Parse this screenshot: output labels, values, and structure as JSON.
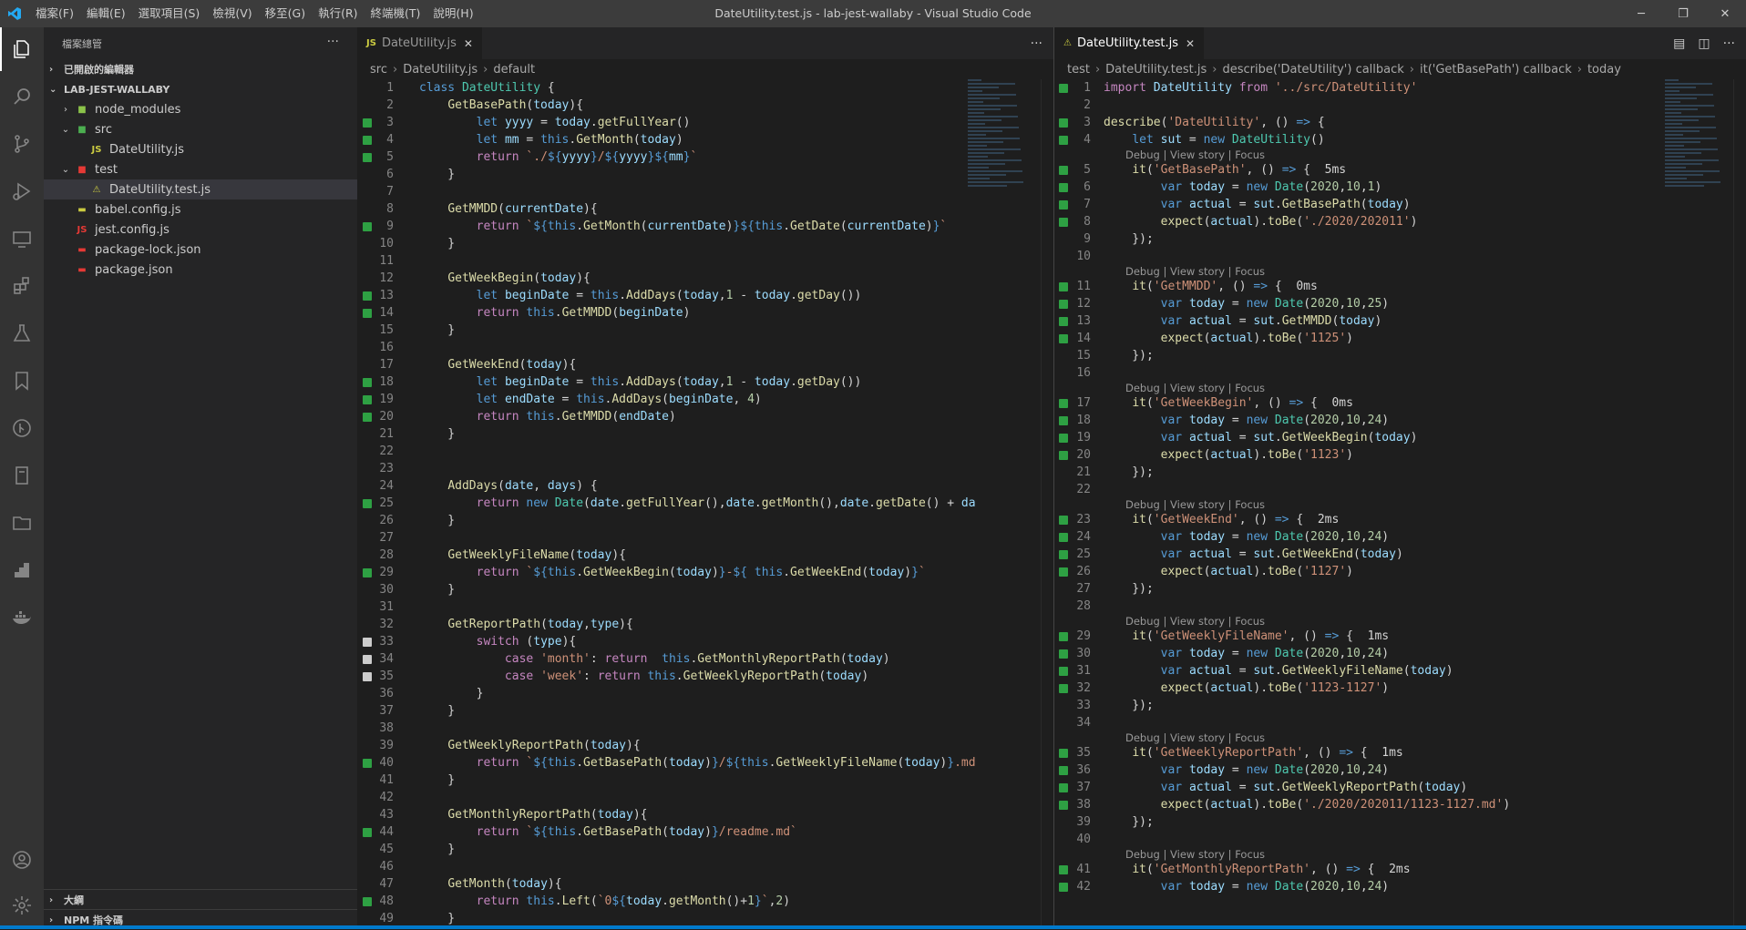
{
  "window": {
    "title": "DateUtility.test.js - lab-jest-wallaby - Visual Studio Code"
  },
  "menu": [
    "檔案(F)",
    "編輯(E)",
    "選取項目(S)",
    "檢視(V)",
    "移至(G)",
    "執行(R)",
    "終端機(T)",
    "說明(H)"
  ],
  "sidebar": {
    "header": "檔案總管",
    "open_editors": "已開啟的編輯器",
    "project": "LAB-JEST-WALLABY",
    "tree": [
      {
        "label": "node_modules",
        "indent": 1,
        "chev": "›",
        "icon": "■",
        "color": "#8bc34a"
      },
      {
        "label": "src",
        "indent": 1,
        "chev": "⌄",
        "icon": "■",
        "color": "#4caf50"
      },
      {
        "label": "DateUtility.js",
        "indent": 2,
        "chev": "",
        "icon": "JS",
        "color": "#cbcb41"
      },
      {
        "label": "test",
        "indent": 1,
        "chev": "⌄",
        "icon": "■",
        "color": "#e53935"
      },
      {
        "label": "DateUtility.test.js",
        "indent": 2,
        "chev": "",
        "icon": "⚠",
        "color": "#cbcb41",
        "selected": true
      },
      {
        "label": "babel.config.js",
        "indent": 1,
        "chev": "",
        "icon": "▬",
        "color": "#cbcb41"
      },
      {
        "label": "jest.config.js",
        "indent": 1,
        "chev": "",
        "icon": "JS",
        "color": "#e53935"
      },
      {
        "label": "package-lock.json",
        "indent": 1,
        "chev": "",
        "icon": "▬",
        "color": "#e53935"
      },
      {
        "label": "package.json",
        "indent": 1,
        "chev": "",
        "icon": "▬",
        "color": "#e53935"
      }
    ],
    "outline": "大綱",
    "npm": "NPM 指令碼"
  },
  "left_editor": {
    "tab": "DateUtility.js",
    "breadcrumb": [
      "src",
      "DateUtility.js",
      "default"
    ],
    "lines": [
      {
        "n": 1,
        "m": "",
        "h": "<span class='k'>class</span> <span class='t'>DateUtility</span> {"
      },
      {
        "n": 2,
        "m": "",
        "h": "    <span class='f'>GetBasePath</span>(<span class='v'>today</span>){"
      },
      {
        "n": 3,
        "m": "g",
        "h": "        <span class='k'>let</span> <span class='v'>yyyy</span> = <span class='v'>today</span>.<span class='f'>getFullYear</span>()"
      },
      {
        "n": 4,
        "m": "g",
        "h": "        <span class='k'>let</span> <span class='v'>mm</span> = <span class='k'>this</span>.<span class='f'>GetMonth</span>(<span class='v'>today</span>)"
      },
      {
        "n": 5,
        "m": "g",
        "h": "        <span class='c'>return</span> <span class='s'>`./</span><span class='k'>${</span><span class='v'>yyyy</span><span class='k'>}</span><span class='s'>/</span><span class='k'>${</span><span class='v'>yyyy</span><span class='k'>}${</span><span class='v'>mm</span><span class='k'>}</span><span class='s'>`</span>"
      },
      {
        "n": 6,
        "m": "",
        "h": "    }"
      },
      {
        "n": 7,
        "m": "",
        "h": ""
      },
      {
        "n": 8,
        "m": "",
        "h": "    <span class='f'>GetMMDD</span>(<span class='v'>currentDate</span>){"
      },
      {
        "n": 9,
        "m": "g",
        "h": "        <span class='c'>return</span> <span class='s'>`</span><span class='k'>${this</span>.<span class='f'>GetMonth</span>(<span class='v'>currentDate</span>)<span class='k'>}${this</span>.<span class='f'>GetDate</span>(<span class='v'>currentDate</span>)<span class='k'>}</span><span class='s'>`</span>"
      },
      {
        "n": 10,
        "m": "",
        "h": "    }"
      },
      {
        "n": 11,
        "m": "",
        "h": ""
      },
      {
        "n": 12,
        "m": "",
        "h": "    <span class='f'>GetWeekBegin</span>(<span class='v'>today</span>){"
      },
      {
        "n": 13,
        "m": "g",
        "h": "        <span class='k'>let</span> <span class='v'>beginDate</span> = <span class='k'>this</span>.<span class='f'>AddDays</span>(<span class='v'>today</span>,<span class='n'>1</span> - <span class='v'>today</span>.<span class='f'>getDay</span>())"
      },
      {
        "n": 14,
        "m": "g",
        "h": "        <span class='c'>return</span> <span class='k'>this</span>.<span class='f'>GetMMDD</span>(<span class='v'>beginDate</span>)"
      },
      {
        "n": 15,
        "m": "",
        "h": "    }"
      },
      {
        "n": 16,
        "m": "",
        "h": ""
      },
      {
        "n": 17,
        "m": "",
        "h": "    <span class='f'>GetWeekEnd</span>(<span class='v'>today</span>){"
      },
      {
        "n": 18,
        "m": "g",
        "h": "        <span class='k'>let</span> <span class='v'>beginDate</span> = <span class='k'>this</span>.<span class='f'>AddDays</span>(<span class='v'>today</span>,<span class='n'>1</span> - <span class='v'>today</span>.<span class='f'>getDay</span>())"
      },
      {
        "n": 19,
        "m": "g",
        "h": "        <span class='k'>let</span> <span class='v'>endDate</span> = <span class='k'>this</span>.<span class='f'>AddDays</span>(<span class='v'>beginDate</span>, <span class='n'>4</span>)"
      },
      {
        "n": 20,
        "m": "g",
        "h": "        <span class='c'>return</span> <span class='k'>this</span>.<span class='f'>GetMMDD</span>(<span class='v'>endDate</span>)"
      },
      {
        "n": 21,
        "m": "",
        "h": "    }"
      },
      {
        "n": 22,
        "m": "",
        "h": ""
      },
      {
        "n": 23,
        "m": "",
        "h": ""
      },
      {
        "n": 24,
        "m": "",
        "h": "    <span class='f'>AddDays</span>(<span class='v'>date</span>, <span class='v'>days</span>) {"
      },
      {
        "n": 25,
        "m": "g",
        "h": "        <span class='c'>return</span> <span class='k'>new</span> <span class='t'>Date</span>(<span class='v'>date</span>.<span class='f'>getFullYear</span>(),<span class='v'>date</span>.<span class='f'>getMonth</span>(),<span class='v'>date</span>.<span class='f'>getDate</span>() + <span class='v'>da</span>"
      },
      {
        "n": 26,
        "m": "",
        "h": "    }"
      },
      {
        "n": 27,
        "m": "",
        "h": ""
      },
      {
        "n": 28,
        "m": "",
        "h": "    <span class='f'>GetWeeklyFileName</span>(<span class='v'>today</span>){"
      },
      {
        "n": 29,
        "m": "g",
        "h": "        <span class='c'>return</span> <span class='s'>`</span><span class='k'>${this</span>.<span class='f'>GetWeekBegin</span>(<span class='v'>today</span>)<span class='k'>}</span><span class='s'>-</span><span class='k'>${</span> <span class='k'>this</span>.<span class='f'>GetWeekEnd</span>(<span class='v'>today</span>)<span class='k'>}</span><span class='s'>`</span>"
      },
      {
        "n": 30,
        "m": "",
        "h": "    }"
      },
      {
        "n": 31,
        "m": "",
        "h": ""
      },
      {
        "n": 32,
        "m": "",
        "h": "    <span class='f'>GetReportPath</span>(<span class='v'>today</span>,<span class='v'>type</span>){"
      },
      {
        "n": 33,
        "m": "w",
        "h": "        <span class='c'>switch</span> (<span class='v'>type</span>){"
      },
      {
        "n": 34,
        "m": "w",
        "h": "            <span class='c'>case</span> <span class='s'>'month'</span>: <span class='c'>return</span>  <span class='k'>this</span>.<span class='f'>GetMonthlyReportPath</span>(<span class='v'>today</span>)"
      },
      {
        "n": 35,
        "m": "w",
        "h": "            <span class='c'>case</span> <span class='s'>'week'</span>: <span class='c'>return</span> <span class='k'>this</span>.<span class='f'>GetWeeklyReportPath</span>(<span class='v'>today</span>)"
      },
      {
        "n": 36,
        "m": "",
        "h": "        }"
      },
      {
        "n": 37,
        "m": "",
        "h": "    }"
      },
      {
        "n": 38,
        "m": "",
        "h": ""
      },
      {
        "n": 39,
        "m": "",
        "h": "    <span class='f'>GetWeeklyReportPath</span>(<span class='v'>today</span>){"
      },
      {
        "n": 40,
        "m": "g",
        "h": "        <span class='c'>return</span> <span class='s'>`</span><span class='k'>${this</span>.<span class='f'>GetBasePath</span>(<span class='v'>today</span>)<span class='k'>}</span><span class='s'>/</span><span class='k'>${this</span>.<span class='f'>GetWeeklyFileName</span>(<span class='v'>today</span>)<span class='k'>}</span><span class='s'>.md</span>"
      },
      {
        "n": 41,
        "m": "",
        "h": "    }"
      },
      {
        "n": 42,
        "m": "",
        "h": ""
      },
      {
        "n": 43,
        "m": "",
        "h": "    <span class='f'>GetMonthlyReportPath</span>(<span class='v'>today</span>){"
      },
      {
        "n": 44,
        "m": "g",
        "h": "        <span class='c'>return</span> <span class='s'>`</span><span class='k'>${this</span>.<span class='f'>GetBasePath</span>(<span class='v'>today</span>)<span class='k'>}</span><span class='s'>/readme.md`</span>"
      },
      {
        "n": 45,
        "m": "",
        "h": "    }"
      },
      {
        "n": 46,
        "m": "",
        "h": ""
      },
      {
        "n": 47,
        "m": "",
        "h": "    <span class='f'>GetMonth</span>(<span class='v'>today</span>){"
      },
      {
        "n": 48,
        "m": "g",
        "h": "        <span class='c'>return</span> <span class='k'>this</span>.<span class='f'>Left</span>(<span class='s'>`0</span><span class='k'>${</span><span class='v'>today</span>.<span class='f'>getMonth</span>()+<span class='n'>1</span><span class='k'>}</span><span class='s'>`</span>,<span class='n'>2</span>)"
      },
      {
        "n": 49,
        "m": "",
        "h": "    }"
      }
    ]
  },
  "right_editor": {
    "tab": "DateUtility.test.js",
    "breadcrumb": [
      "test",
      "DateUtility.test.js",
      "describe('DateUtility') callback",
      "it('GetBasePath') callback",
      "today"
    ],
    "lens_text": "Debug | View story | Focus",
    "lines": [
      {
        "n": 1,
        "m": "g",
        "h": "<span class='c'>import</span> <span class='v'>DateUtility</span> <span class='c'>from</span> <span class='s'>'../src/DateUtility'</span>"
      },
      {
        "n": 2,
        "m": "",
        "h": ""
      },
      {
        "n": 3,
        "m": "g",
        "h": "<span class='f'>describe</span>(<span class='s'>'DateUtility'</span>, () <span class='k'>=&gt;</span> {"
      },
      {
        "n": 4,
        "m": "g",
        "h": "    <span class='k'>let</span> <span class='v'>sut</span> = <span class='k'>new</span> <span class='t'>DateUtility</span>()"
      },
      {
        "lens": true
      },
      {
        "n": 5,
        "m": "g",
        "h": "    <span class='f'>it</span>(<span class='s'>'GetBasePath'</span>, () <span class='k'>=&gt;</span> {  <span class='p'>5ms</span>"
      },
      {
        "n": 6,
        "m": "g",
        "h": "        <span class='k'>var</span> <span class='v'>today</span> = <span class='k'>new</span> <span class='t'>Date</span>(<span class='n'>2020</span>,<span class='n'>10</span>,<span class='n'>1</span>)"
      },
      {
        "n": 7,
        "m": "g",
        "h": "        <span class='k'>var</span> <span class='v'>actual</span> = <span class='v'>sut</span>.<span class='f'>GetBasePath</span>(<span class='v'>today</span>)"
      },
      {
        "n": 8,
        "m": "g",
        "h": "        <span class='f'>expect</span>(<span class='v'>actual</span>).<span class='f'>toBe</span>(<span class='s'>'./2020/202011'</span>)"
      },
      {
        "n": 9,
        "m": "",
        "h": "    });"
      },
      {
        "n": 10,
        "m": "",
        "h": ""
      },
      {
        "lens": true
      },
      {
        "n": 11,
        "m": "g",
        "h": "    <span class='f'>it</span>(<span class='s'>'GetMMDD'</span>, () <span class='k'>=&gt;</span> {  <span class='p'>0ms</span>"
      },
      {
        "n": 12,
        "m": "g",
        "h": "        <span class='k'>var</span> <span class='v'>today</span> = <span class='k'>new</span> <span class='t'>Date</span>(<span class='n'>2020</span>,<span class='n'>10</span>,<span class='n'>25</span>)"
      },
      {
        "n": 13,
        "m": "g",
        "h": "        <span class='k'>var</span> <span class='v'>actual</span> = <span class='v'>sut</span>.<span class='f'>GetMMDD</span>(<span class='v'>today</span>)"
      },
      {
        "n": 14,
        "m": "g",
        "h": "        <span class='f'>expect</span>(<span class='v'>actual</span>).<span class='f'>toBe</span>(<span class='s'>'1125'</span>)"
      },
      {
        "n": 15,
        "m": "",
        "h": "    });"
      },
      {
        "n": 16,
        "m": "",
        "h": ""
      },
      {
        "lens": true
      },
      {
        "n": 17,
        "m": "g",
        "h": "    <span class='f'>it</span>(<span class='s'>'GetWeekBegin'</span>, () <span class='k'>=&gt;</span> {  <span class='p'>0ms</span>"
      },
      {
        "n": 18,
        "m": "g",
        "h": "        <span class='k'>var</span> <span class='v'>today</span> = <span class='k'>new</span> <span class='t'>Date</span>(<span class='n'>2020</span>,<span class='n'>10</span>,<span class='n'>24</span>)"
      },
      {
        "n": 19,
        "m": "g",
        "h": "        <span class='k'>var</span> <span class='v'>actual</span> = <span class='v'>sut</span>.<span class='f'>GetWeekBegin</span>(<span class='v'>today</span>)"
      },
      {
        "n": 20,
        "m": "g",
        "h": "        <span class='f'>expect</span>(<span class='v'>actual</span>).<span class='f'>toBe</span>(<span class='s'>'1123'</span>)"
      },
      {
        "n": 21,
        "m": "",
        "h": "    });"
      },
      {
        "n": 22,
        "m": "",
        "h": ""
      },
      {
        "lens": true
      },
      {
        "n": 23,
        "m": "g",
        "h": "    <span class='f'>it</span>(<span class='s'>'GetWeekEnd'</span>, () <span class='k'>=&gt;</span> {  <span class='p'>2ms</span>"
      },
      {
        "n": 24,
        "m": "g",
        "h": "        <span class='k'>var</span> <span class='v'>today</span> = <span class='k'>new</span> <span class='t'>Date</span>(<span class='n'>2020</span>,<span class='n'>10</span>,<span class='n'>24</span>)"
      },
      {
        "n": 25,
        "m": "g",
        "h": "        <span class='k'>var</span> <span class='v'>actual</span> = <span class='v'>sut</span>.<span class='f'>GetWeekEnd</span>(<span class='v'>today</span>)"
      },
      {
        "n": 26,
        "m": "g",
        "h": "        <span class='f'>expect</span>(<span class='v'>actual</span>).<span class='f'>toBe</span>(<span class='s'>'1127'</span>)"
      },
      {
        "n": 27,
        "m": "",
        "h": "    });"
      },
      {
        "n": 28,
        "m": "",
        "h": ""
      },
      {
        "lens": true
      },
      {
        "n": 29,
        "m": "g",
        "h": "    <span class='f'>it</span>(<span class='s'>'GetWeeklyFileName'</span>, () <span class='k'>=&gt;</span> {  <span class='p'>1ms</span>"
      },
      {
        "n": 30,
        "m": "g",
        "h": "        <span class='k'>var</span> <span class='v'>today</span> = <span class='k'>new</span> <span class='t'>Date</span>(<span class='n'>2020</span>,<span class='n'>10</span>,<span class='n'>24</span>)"
      },
      {
        "n": 31,
        "m": "g",
        "h": "        <span class='k'>var</span> <span class='v'>actual</span> = <span class='v'>sut</span>.<span class='f'>GetWeeklyFileName</span>(<span class='v'>today</span>)"
      },
      {
        "n": 32,
        "m": "g",
        "h": "        <span class='f'>expect</span>(<span class='v'>actual</span>).<span class='f'>toBe</span>(<span class='s'>'1123-1127'</span>)"
      },
      {
        "n": 33,
        "m": "",
        "h": "    });"
      },
      {
        "n": 34,
        "m": "",
        "h": ""
      },
      {
        "lens": true
      },
      {
        "n": 35,
        "m": "g",
        "h": "    <span class='f'>it</span>(<span class='s'>'GetWeeklyReportPath'</span>, () <span class='k'>=&gt;</span> {  <span class='p'>1ms</span>"
      },
      {
        "n": 36,
        "m": "g",
        "h": "        <span class='k'>var</span> <span class='v'>today</span> = <span class='k'>new</span> <span class='t'>Date</span>(<span class='n'>2020</span>,<span class='n'>10</span>,<span class='n'>24</span>)"
      },
      {
        "n": 37,
        "m": "g",
        "h": "        <span class='k'>var</span> <span class='v'>actual</span> = <span class='v'>sut</span>.<span class='f'>GetWeeklyReportPath</span>(<span class='v'>today</span>)"
      },
      {
        "n": 38,
        "m": "g",
        "h": "        <span class='f'>expect</span>(<span class='v'>actual</span>).<span class='f'>toBe</span>(<span class='s'>'./2020/202011/1123-1127.md'</span>)"
      },
      {
        "n": 39,
        "m": "",
        "h": "    });"
      },
      {
        "n": 40,
        "m": "",
        "h": ""
      },
      {
        "lens": true
      },
      {
        "n": 41,
        "m": "g",
        "h": "    <span class='f'>it</span>(<span class='s'>'GetMonthlyReportPath'</span>, () <span class='k'>=&gt;</span> {  <span class='p'>2ms</span>"
      },
      {
        "n": 42,
        "m": "g",
        "h": "        <span class='k'>var</span> <span class='v'>today</span> = <span class='k'>new</span> <span class='t'>Date</span>(<span class='n'>2020</span>,<span class='n'>10</span>,<span class='n'>24</span>)"
      }
    ]
  }
}
